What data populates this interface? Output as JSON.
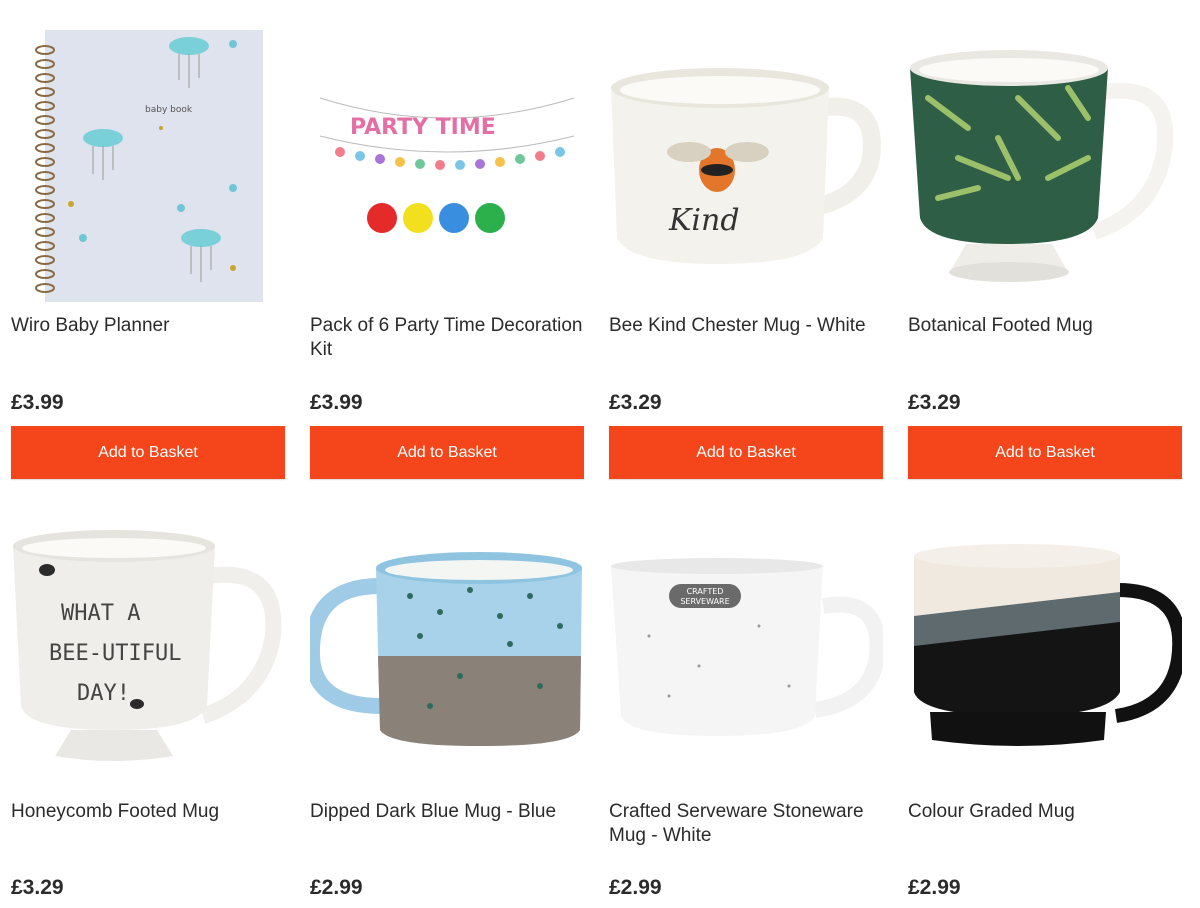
{
  "products": [
    {
      "title": "Wiro Baby Planner",
      "price": "£3.99",
      "button": "Add to Basket"
    },
    {
      "title": "Pack of 6 Party Time Decoration Kit",
      "price": "£3.99",
      "button": "Add to Basket"
    },
    {
      "title": "Bee Kind Chester Mug - White",
      "price": "£3.29",
      "button": "Add to Basket"
    },
    {
      "title": "Botanical Footed Mug",
      "price": "£3.29",
      "button": "Add to Basket"
    },
    {
      "title": "Honeycomb Footed Mug",
      "price": "£3.29"
    },
    {
      "title": "Dipped Dark Blue Mug - Blue",
      "price": "£2.99"
    },
    {
      "title": "Crafted Serveware Stoneware Mug - White",
      "price": "£2.99"
    },
    {
      "title": "Colour Graded Mug",
      "price": "£2.99"
    }
  ],
  "images": {
    "planner": {
      "text": "baby book"
    },
    "party": {
      "text": "PARTY TIME"
    },
    "bee_kind": {
      "text": "Kind"
    },
    "honeycomb": {
      "line1": "WHAT A",
      "line2": "BEE-UTIFUL",
      "line3": "DAY!"
    },
    "crafted": {
      "line1": "CRAFTED",
      "line2": "SERVEWARE"
    }
  },
  "colors": {
    "button": "#f4461a",
    "text": "#2b2b2b"
  }
}
